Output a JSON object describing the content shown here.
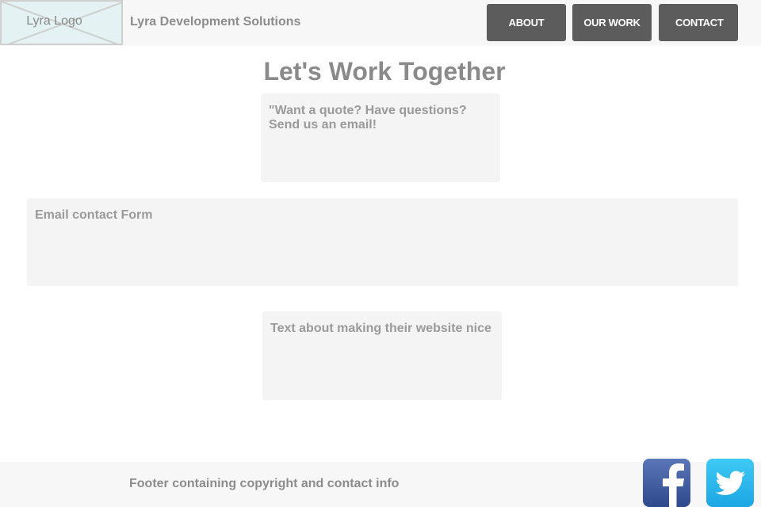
{
  "header": {
    "logo_text": "Lyra Logo",
    "company_name": "Lyra Development Solutions",
    "nav": [
      {
        "label": "ABOUT"
      },
      {
        "label": "OUR WORK"
      },
      {
        "label": "CONTACT"
      }
    ]
  },
  "main": {
    "title": "Let's Work Together",
    "quote_box": "\"Want a quote? Have questions? Send us an email!",
    "form_box": "Email contact Form",
    "info_box": "Text about making their website nice"
  },
  "footer": {
    "text": "Footer containing copyright and contact info",
    "social": [
      {
        "icon": "facebook-icon",
        "color": "#3b5998"
      },
      {
        "icon": "twitter-icon",
        "color": "#1da1f2"
      }
    ]
  }
}
